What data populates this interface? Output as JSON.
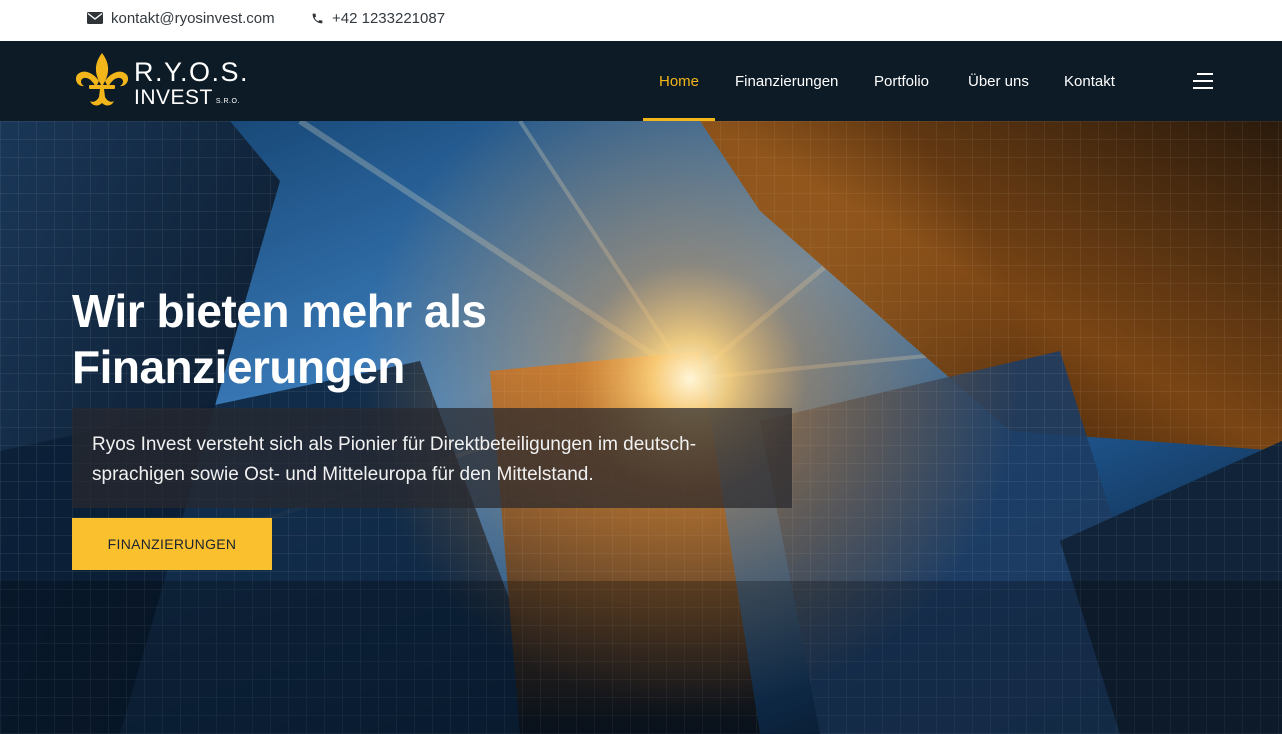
{
  "topbar": {
    "email": "kontakt@ryosinvest.com",
    "phone": "+42 1233221087"
  },
  "brand": {
    "name": "R.Y.O.S.",
    "subtitle": "INVEST",
    "legal_form": "S.R.O."
  },
  "nav": {
    "items": [
      {
        "label": "Home",
        "active": true
      },
      {
        "label": "Finanzierungen",
        "active": false
      },
      {
        "label": "Portfolio",
        "active": false
      },
      {
        "label": "Über uns",
        "active": false
      },
      {
        "label": "Kontakt",
        "active": false
      }
    ],
    "menu_icon": "hamburger-icon"
  },
  "hero": {
    "title_line1": "Wir bieten mehr als",
    "title_line2": "Finanzierungen",
    "description": "Ryos Invest versteht sich als Pionier für Direktbeteiligungen im deutsch-sprachigen sowie Ost- und Mitteleuropa für den Mittelstand.",
    "cta_label": "FINANZIERUNGEN"
  },
  "colors": {
    "accent": "#fbc02d",
    "nav_active": "#f2b61a",
    "navbar_bg": "#0d1b26",
    "topbar_bg": "#ffffff"
  }
}
